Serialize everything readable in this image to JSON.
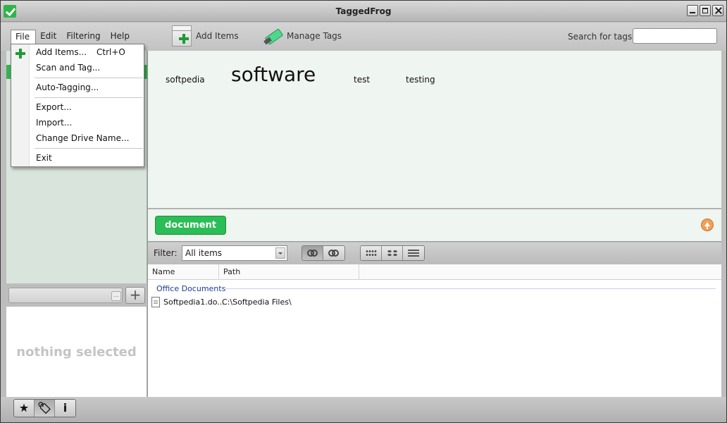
{
  "window": {
    "title": "TaggedFrog"
  },
  "menu": {
    "file": "File",
    "edit": "Edit",
    "filtering": "Filtering",
    "help": "Help"
  },
  "toolbar": {
    "add_items": "Add Items",
    "manage_tags": "Manage Tags",
    "search_label": "Search for tags",
    "search_value": ""
  },
  "file_menu": {
    "items": [
      {
        "label": "Add Items...",
        "shortcut": "Ctrl+O"
      },
      {
        "label": "Scan and Tag..."
      },
      {
        "label": "Auto-Tagging..."
      },
      {
        "label": "Export..."
      },
      {
        "label": "Import..."
      },
      {
        "label": "Change Drive Name..."
      },
      {
        "label": "Exit"
      }
    ]
  },
  "tag_cloud": {
    "tags": [
      "softpedia",
      "software",
      "test",
      "testing"
    ]
  },
  "selected_tags": {
    "chips": [
      "document"
    ]
  },
  "filter": {
    "label": "Filter:",
    "value": "All items"
  },
  "file_list": {
    "columns": [
      "Name",
      "Path"
    ],
    "group": "Office Documents",
    "rows": [
      {
        "name": "Softpedia1.do...",
        "path": "C:\\Softpedia Files\\"
      }
    ]
  },
  "info_panel": {
    "empty_text": "nothing selected"
  },
  "bottom_tabs": {
    "star": "★",
    "info": "i"
  }
}
